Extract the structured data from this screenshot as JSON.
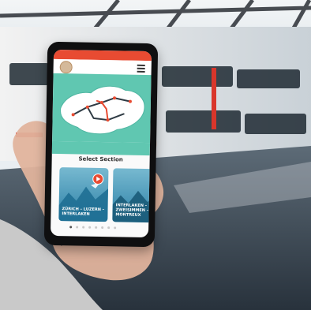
{
  "app": {
    "section_title": "Select Section",
    "cards": [
      {
        "label": "ZÜRICH – LUZERN – INTERLAKEN"
      },
      {
        "label": "INTERLAKEN – ZWEISIMMEN – MONTREUX"
      }
    ],
    "pager": {
      "dots": 8,
      "active_index": 0
    }
  }
}
